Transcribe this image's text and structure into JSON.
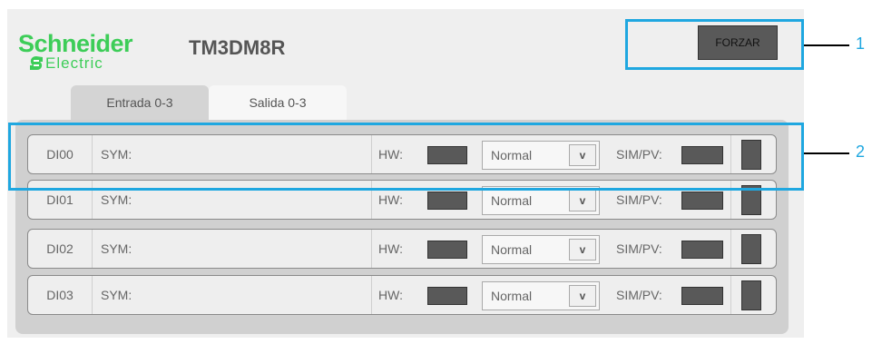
{
  "brand": {
    "name": "Schneider",
    "sub": "Electric"
  },
  "device": "TM3DM8R",
  "force_label": "FORZAR",
  "tabs": [
    {
      "label": "Entrada 0-3"
    },
    {
      "label": "Salida 0-3"
    }
  ],
  "rows": [
    {
      "id": "DI00",
      "sym": "SYM:",
      "hw": "HW:",
      "mode": "Normal",
      "sim": "SIM/PV:"
    },
    {
      "id": "DI01",
      "sym": "SYM:",
      "hw": "HW:",
      "mode": "Normal",
      "sim": "SIM/PV:"
    },
    {
      "id": "DI02",
      "sym": "SYM:",
      "hw": "HW:",
      "mode": "Normal",
      "sim": "SIM/PV:"
    },
    {
      "id": "DI03",
      "sym": "SYM:",
      "hw": "HW:",
      "mode": "Normal",
      "sim": "SIM/PV:"
    }
  ],
  "select_arrow": "v",
  "callouts": [
    {
      "num": "1"
    },
    {
      "num": "2"
    }
  ],
  "colors": {
    "brand_green": "#3dcd58",
    "callout_blue": "#1fa7e0",
    "indicator_gray": "#595959"
  }
}
